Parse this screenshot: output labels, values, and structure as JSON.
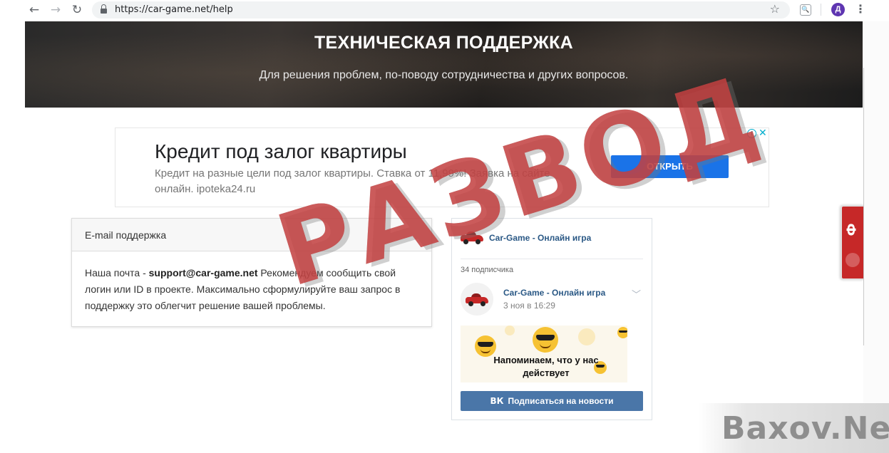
{
  "browser": {
    "url": "https://car-game.net/help",
    "avatar_letter": "Д",
    "ext_label": "🔍"
  },
  "hero": {
    "title": "ТЕХНИЧЕСКАЯ ПОДДЕРЖКА",
    "subtitle": "Для решения проблем, по-поводу сотрудничества и других вопросов."
  },
  "ad": {
    "title": "Кредит под залог квартиры",
    "description": "Кредит на разные цели под залог квартиры. Ставка от 11,99%! Заявка на сайте онлайн. ipoteka24.ru",
    "button_label": "ОТКРЫТЬ",
    "info_label": "i",
    "close_label": "✕"
  },
  "email_card": {
    "header": "E-mail поддержка",
    "body_prefix": "Наша почта - ",
    "email": "support@car-game.net",
    "body_suffix": " Рекомендуем сообщить свой логин или ID в проекте. Максимально сформулируйте ваш запрос в поддержку это облегчит решение вашей проблемы."
  },
  "vk_widget": {
    "group_name": "Car-Game - Онлайн игра",
    "subscribers": "34 подписчика",
    "post_author": "Car-Game - Онлайн игра",
    "post_date": "3 ноя в 16:29",
    "post_image_text": "Напоминаем, что у нас действует",
    "subscribe_label": "Подписаться на новости",
    "subscribe_icon": "ВК"
  },
  "vk_tab": {
    "letter": "Ф"
  },
  "stamp": {
    "text": "РАЗВОД"
  },
  "watermark": {
    "text": "Baxov.Net"
  },
  "colors": {
    "vk_blue": "#4a76a8",
    "ad_button": "#1a73e8",
    "stamp_red": "#d73c3c"
  }
}
